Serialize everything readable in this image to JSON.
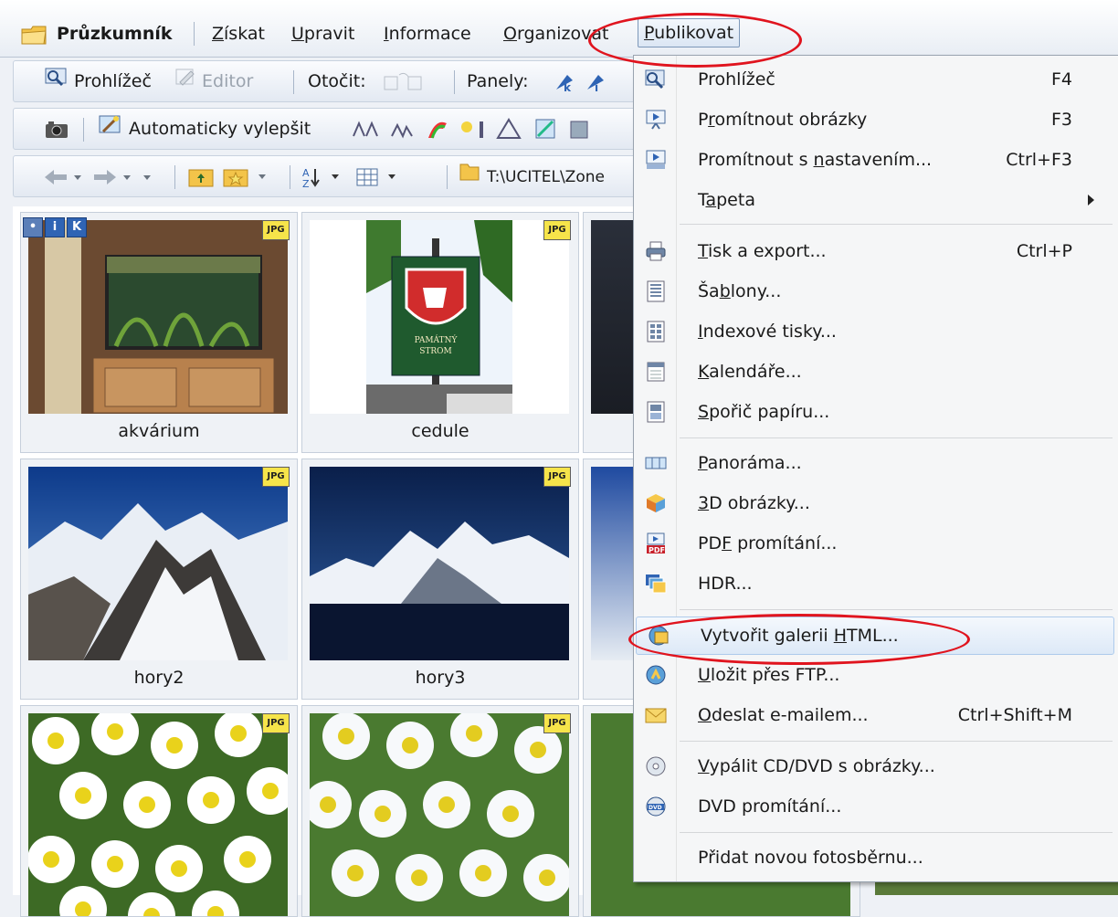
{
  "menubar": {
    "app_name": "Průzkumník",
    "items": [
      {
        "pre": "",
        "u": "Z",
        "post": "ískat"
      },
      {
        "pre": "",
        "u": "U",
        "post": "pravit"
      },
      {
        "pre": "",
        "u": "I",
        "post": "nformace"
      },
      {
        "pre": "",
        "u": "O",
        "post": "rganizovat"
      },
      {
        "pre": "",
        "u": "P",
        "post": "ublikovat"
      }
    ]
  },
  "toolbar1": {
    "viewer": "Prohlížeč",
    "editor": "Editor",
    "rotate": "Otočit:",
    "panels": "Panely:"
  },
  "toolbar2": {
    "auto_enhance": "Automaticky vylepšit"
  },
  "toolbar3": {
    "path": "T:\\UCITEL\\Zone"
  },
  "thumbnails": [
    {
      "name": "akvárium",
      "badge": "JPG"
    },
    {
      "name": "cedule",
      "badge": "JPG",
      "sign_text": [
        "PAMÁTNÝ",
        "STROM"
      ]
    },
    {
      "name": "",
      "badge": ""
    },
    {
      "name": "hory2",
      "badge": "JPG"
    },
    {
      "name": "hory3",
      "badge": "JPG"
    },
    {
      "name": "",
      "badge": ""
    },
    {
      "name": "",
      "badge": "JPG"
    },
    {
      "name": "",
      "badge": "JPG"
    },
    {
      "name": "",
      "badge": ""
    }
  ],
  "info_icons": [
    "i",
    "K"
  ],
  "publish_menu": {
    "items": [
      {
        "pre": "Prohlížeč",
        "u": "",
        "post": "",
        "shortcut": "F4"
      },
      {
        "pre": "P",
        "u": "r",
        "post": "omítnout obrázky",
        "shortcut": "F3"
      },
      {
        "pre": "Promítnout s ",
        "u": "n",
        "post": "astavením...",
        "shortcut": "Ctrl+F3"
      },
      {
        "pre": "T",
        "u": "a",
        "post": "peta",
        "shortcut": ""
      },
      {
        "pre": "",
        "u": "T",
        "post": "isk a export...",
        "shortcut": "Ctrl+P"
      },
      {
        "pre": "Ša",
        "u": "b",
        "post": "lony...",
        "shortcut": ""
      },
      {
        "pre": "",
        "u": "I",
        "post": "ndexové tisky...",
        "shortcut": ""
      },
      {
        "pre": "",
        "u": "K",
        "post": "alendáře...",
        "shortcut": ""
      },
      {
        "pre": "",
        "u": "S",
        "post": "pořič papíru...",
        "shortcut": ""
      },
      {
        "pre": "",
        "u": "P",
        "post": "anoráma...",
        "shortcut": ""
      },
      {
        "pre": "",
        "u": "3",
        "post": "D obrázky...",
        "shortcut": ""
      },
      {
        "pre": "PD",
        "u": "F",
        "post": " promítání...",
        "shortcut": ""
      },
      {
        "pre": "HDR...",
        "u": "",
        "post": "",
        "shortcut": ""
      },
      {
        "pre": "Vytvořit galerii ",
        "u": "H",
        "post": "TML...",
        "shortcut": ""
      },
      {
        "pre": "",
        "u": "U",
        "post": "ložit přes FTP...",
        "shortcut": ""
      },
      {
        "pre": "",
        "u": "O",
        "post": "deslat e-mailem...",
        "shortcut": "Ctrl+Shift+M"
      },
      {
        "pre": "",
        "u": "V",
        "post": "ypálit CD/DVD s obrázky...",
        "shortcut": ""
      },
      {
        "pre": "DVD promítání...",
        "u": "",
        "post": "",
        "shortcut": ""
      },
      {
        "pre": "Přidat novou fotosběrnu...",
        "u": "",
        "post": "",
        "shortcut": ""
      }
    ]
  },
  "colors": {
    "highlight": "#e0141e",
    "accent": "#2f64b4",
    "badge": "#f6e44a"
  }
}
